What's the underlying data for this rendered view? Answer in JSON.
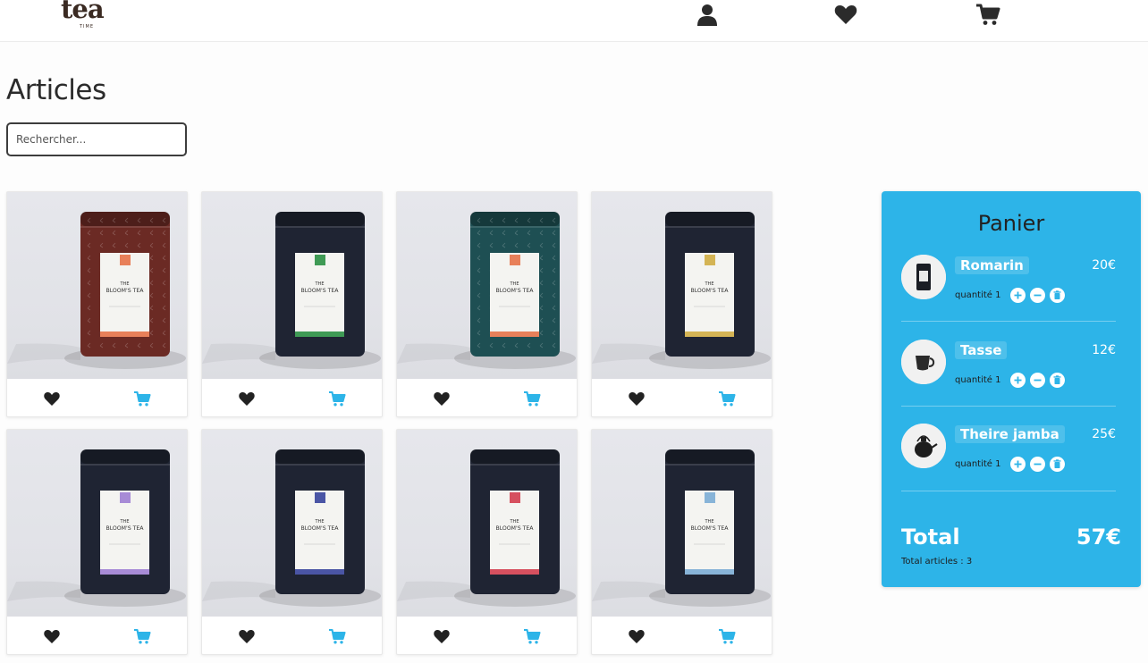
{
  "header": {
    "logo_text": "tea",
    "logo_sub": "TIME",
    "icons": [
      "user-icon",
      "heart-icon",
      "cart-icon"
    ]
  },
  "page": {
    "title": "Articles",
    "search_placeholder": "Rechercher..."
  },
  "products": [
    {
      "color": "#6b2a24",
      "accent": "#e8805a",
      "pattern": true
    },
    {
      "color": "#1f2433",
      "accent": "#3f9a55",
      "pattern": false
    },
    {
      "color": "#1e4f53",
      "accent": "#e8805a",
      "pattern": true
    },
    {
      "color": "#1f2433",
      "accent": "#d4b455",
      "pattern": false
    },
    {
      "color": "#1f2433",
      "accent": "#a78bd6",
      "pattern": false
    },
    {
      "color": "#1f2433",
      "accent": "#4a55a5",
      "pattern": false
    },
    {
      "color": "#1f2433",
      "accent": "#d6505f",
      "pattern": false
    },
    {
      "color": "#1f2433",
      "accent": "#88b4d8",
      "pattern": false
    }
  ],
  "pack_label": {
    "line1": "THE",
    "line2": "BLOOM'S TEA"
  },
  "colors": {
    "accent": "#2db4e8",
    "heart": "#222222",
    "cart": "#2db4e8"
  },
  "panier": {
    "title": "Panier",
    "items": [
      {
        "name": "Romarin",
        "price": "20€",
        "quantity": "quantité 1",
        "thumb": "tea-pack"
      },
      {
        "name": "Tasse",
        "price": "12€",
        "quantity": "quantité 1",
        "thumb": "cup"
      },
      {
        "name": "Theire jamba",
        "price": "25€",
        "quantity": "quantité 1",
        "thumb": "teapot"
      }
    ],
    "total_label": "Total",
    "total_value": "57€",
    "total_count": "Total articles : 3"
  }
}
